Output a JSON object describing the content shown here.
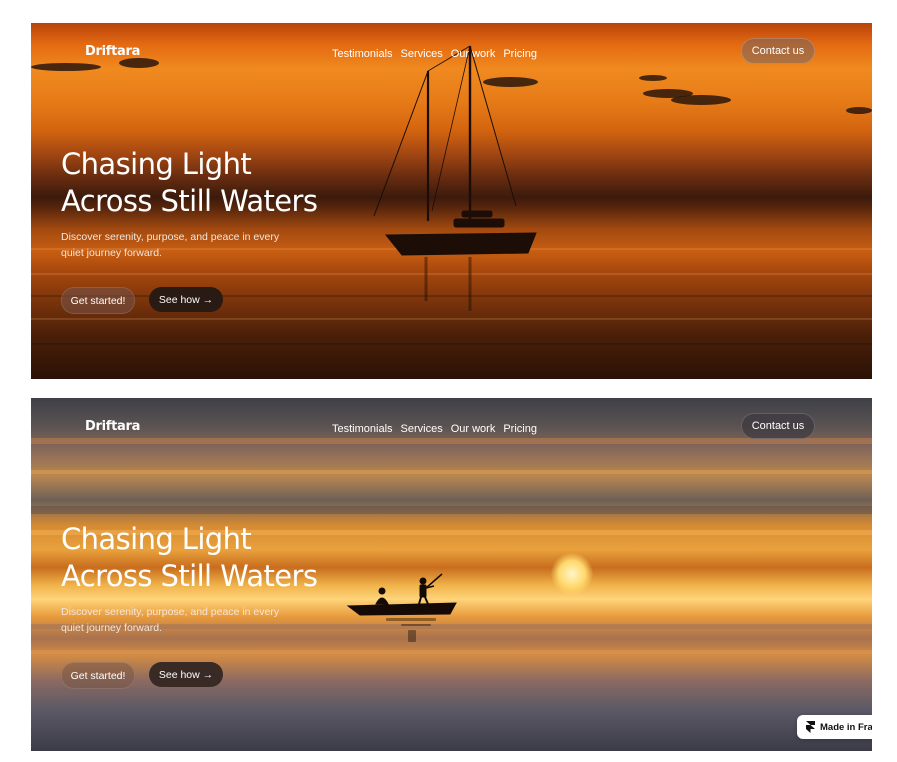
{
  "sections": [
    {
      "brand": "Driftara",
      "nav": [
        "Testimonials",
        "Services",
        "Our work",
        "Pricing"
      ],
      "contact_label": "Contact us",
      "headline_line1": "Chasing Light",
      "headline_line2": "Across Still Waters",
      "subtext": "Discover serenity, purpose, and peace in every quiet journey forward.",
      "primary_cta": "Get started!",
      "secondary_cta": "See how →"
    },
    {
      "brand": "Driftara",
      "nav": [
        "Testimonials",
        "Services",
        "Our work",
        "Pricing"
      ],
      "contact_label": "Contact us",
      "headline_line1": "Chasing Light",
      "headline_line2": "Across Still Waters",
      "subtext": "Discover serenity, purpose, and peace in every quiet journey forward.",
      "primary_cta": "Get started!",
      "secondary_cta": "See how →"
    }
  ],
  "badge": {
    "label": "Made in Fram",
    "icon": "framer-icon"
  },
  "colors": {
    "text": "#ffffff",
    "dark_button": "#2a1a14",
    "sunset_orange": "#e46a12",
    "sky_gray": "#3e4048"
  }
}
